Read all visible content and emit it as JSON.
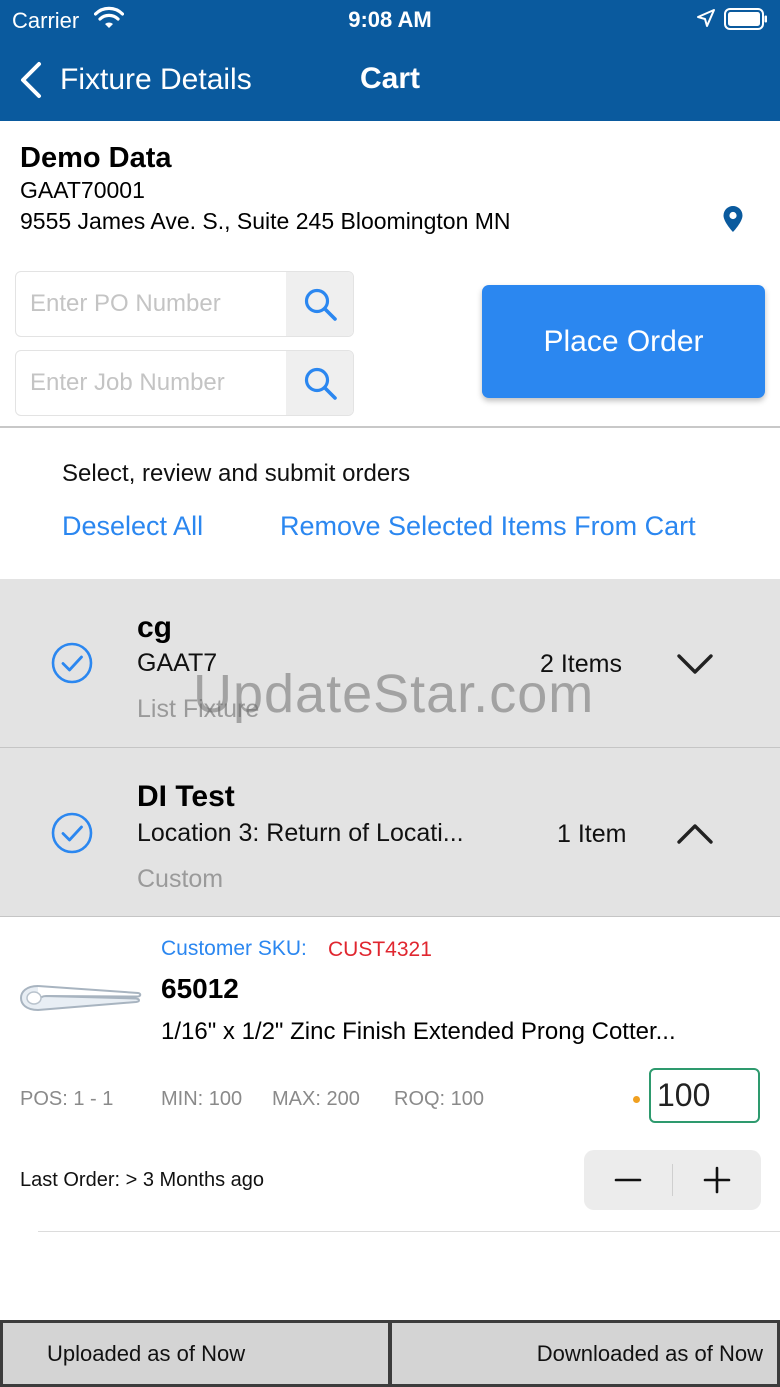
{
  "status_bar": {
    "carrier": "Carrier",
    "time": "9:08 AM"
  },
  "nav": {
    "back_label": "Fixture Details",
    "title": "Cart"
  },
  "customer": {
    "name": "Demo Data",
    "code": "GAAT70001",
    "address": "9555 James Ave. S., Suite 245 Bloomington MN"
  },
  "inputs": {
    "po_placeholder": "Enter PO Number",
    "job_placeholder": "Enter Job Number"
  },
  "place_order_label": "Place Order",
  "instructions": "Select, review and submit orders",
  "actions": {
    "deselect_all": "Deselect All",
    "remove_selected": "Remove Selected Items From Cart"
  },
  "groups": [
    {
      "name": "cg",
      "subtitle": "GAAT7",
      "type": "List Fixture",
      "count": "2 Items",
      "selected": true,
      "expanded": false
    },
    {
      "name": "DI Test",
      "subtitle": "Location 3: Return of Locati...",
      "type": "Custom",
      "count": "1 Item",
      "selected": true,
      "expanded": true
    }
  ],
  "watermark": "UpdateStar.com",
  "item": {
    "sku_label": "Customer SKU:",
    "sku_value": "CUST4321",
    "number": "65012",
    "description": "1/16\" x 1/2\" Zinc Finish Extended Prong Cotter...",
    "pos": "POS: 1 - 1",
    "min": "MIN: 100",
    "max": "MAX: 200",
    "roq": "ROQ: 100",
    "quantity": "100",
    "last_order": "Last Order: > 3 Months ago"
  },
  "footer": {
    "uploaded": "Uploaded as of Now",
    "downloaded": "Downloaded as of Now"
  },
  "colors": {
    "nav_bar": "#0a5a9e",
    "accent_blue": "#2b87f0",
    "sku_red": "#e0262f",
    "qty_border_green": "#2e9a6e",
    "group_bg": "#e3e3e3"
  },
  "icons": [
    "wifi-icon",
    "location-arrow-icon",
    "battery-icon",
    "back-chevron-icon",
    "map-pin-icon",
    "search-icon",
    "check-circle-icon",
    "chevron-down-icon",
    "chevron-up-icon",
    "minus-icon",
    "plus-icon"
  ]
}
